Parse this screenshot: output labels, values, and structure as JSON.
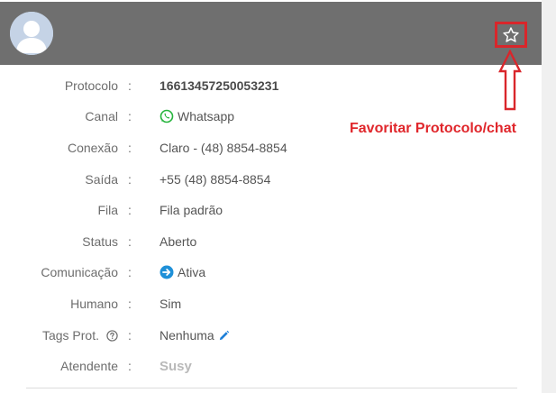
{
  "header": {
    "avatar_icon": "user-avatar-icon",
    "favorite_icon": "star-outline-icon",
    "background": "#6f6f6f"
  },
  "annotation": {
    "text": "Favoritar Protocolo/chat",
    "color": "#e0262b"
  },
  "details": {
    "protocolo_label": "Protocolo",
    "protocolo_value": "16613457250053231",
    "canal_label": "Canal",
    "canal_icon": "whatsapp-icon",
    "canal_value": "Whatsapp",
    "conexao_label": "Conexão",
    "conexao_value": "Claro - (48) 8854-8854",
    "saida_label": "Saída",
    "saida_value": "+55 (48) 8854-8854",
    "fila_label": "Fila",
    "fila_value": "Fila padrão",
    "status_label": "Status",
    "status_value": "Aberto",
    "comunicacao_label": "Comunicação",
    "comunicacao_icon": "arrow-circle-right-icon",
    "comunicacao_value": "Ativa",
    "humano_label": "Humano",
    "humano_value": "Sim",
    "tags_label": "Tags Prot.",
    "tags_help_icon": "question-circle-icon",
    "tags_value": "Nenhuma",
    "tags_edit_icon": "pencil-icon",
    "atendente_label": "Atendente",
    "atendente_value": "Susy",
    "separator": ":"
  }
}
